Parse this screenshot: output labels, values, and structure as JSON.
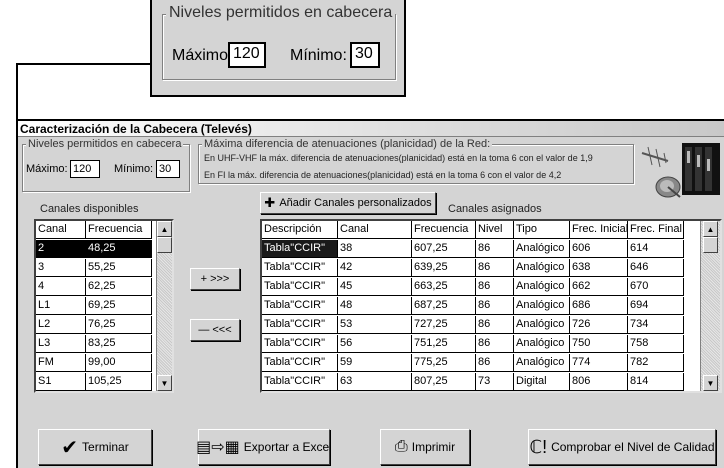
{
  "zoom": {
    "legend": "Niveles permitidos en cabecera",
    "max_label": "Máximo:",
    "max_value": "120",
    "min_label": "Mínimo:",
    "min_value": "30"
  },
  "window": {
    "title": "Caracterización de la Cabecera  (Televés)"
  },
  "niveles": {
    "legend": "Niveles permitidos en cabecera",
    "max_label": "Máximo:",
    "max_value": "120",
    "min_label": "Mínimo:",
    "min_value": "30"
  },
  "planicidad": {
    "legend": "Máxima diferencia de atenuaciones (planicidad) de la Red:",
    "line1": "En UHF-VHF la máx. diferencia de atenuaciones(planicidad) está en la toma 6 con el valor de 1,9",
    "line2": "En FI la máx. diferencia de atenuaciones(planicidad) está en la toma 6 con el valor de 4,2"
  },
  "disponibles": {
    "label": "Canales disponibles",
    "columns": [
      "Canal",
      "Frecuencia"
    ],
    "rows": [
      [
        "2",
        "48,25"
      ],
      [
        "3",
        "55,25"
      ],
      [
        "4",
        "62,25"
      ],
      [
        "L1",
        "69,25"
      ],
      [
        "L2",
        "76,25"
      ],
      [
        "L3",
        "83,25"
      ],
      [
        "FM",
        "99,00"
      ],
      [
        "S1",
        "105,25"
      ]
    ]
  },
  "asignados": {
    "label": "Canales asignados",
    "columns": [
      "Descripción",
      "Canal",
      "Frecuencia",
      "Nivel",
      "Tipo",
      "Frec. Inicial",
      "Frec. Final"
    ],
    "rows": [
      [
        "Tabla\"CCIR\"",
        "38",
        "607,25",
        "86",
        "Analógico",
        "606",
        "614"
      ],
      [
        "Tabla\"CCIR\"",
        "42",
        "639,25",
        "86",
        "Analógico",
        "638",
        "646"
      ],
      [
        "Tabla\"CCIR\"",
        "45",
        "663,25",
        "86",
        "Analógico",
        "662",
        "670"
      ],
      [
        "Tabla\"CCIR\"",
        "48",
        "687,25",
        "86",
        "Analógico",
        "686",
        "694"
      ],
      [
        "Tabla\"CCIR\"",
        "53",
        "727,25",
        "86",
        "Analógico",
        "726",
        "734"
      ],
      [
        "Tabla\"CCIR\"",
        "56",
        "751,25",
        "86",
        "Analógico",
        "750",
        "758"
      ],
      [
        "Tabla\"CCIR\"",
        "59",
        "775,25",
        "86",
        "Analógico",
        "774",
        "782"
      ],
      [
        "Tabla\"CCIR\"",
        "63",
        "807,25",
        "73",
        "Digital",
        "806",
        "814"
      ]
    ]
  },
  "buttons": {
    "add_custom": "Añadir Canales  personalizados",
    "add_channel": "+ >>>",
    "remove_channel": "— <<<",
    "finish": "Terminar",
    "export_excel": "Exportar a Excel",
    "print": "Imprimir",
    "check_quality": "Comprobar el Nivel de Calidad"
  }
}
